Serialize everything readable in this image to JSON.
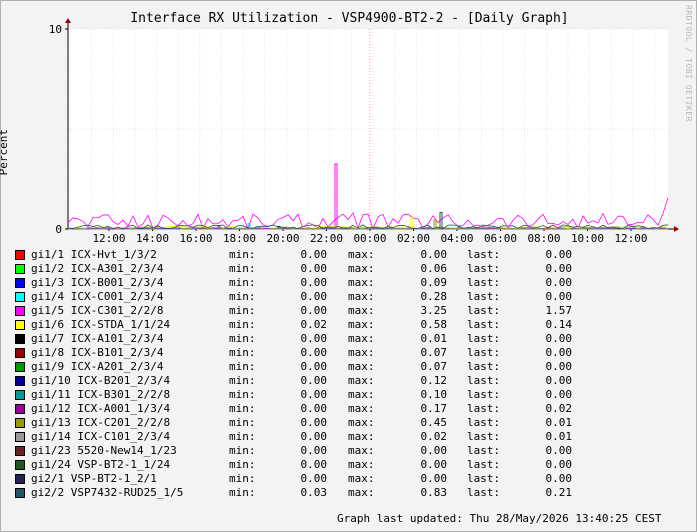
{
  "title": "Interface RX Utilization - VSP4900-BT2-2 - [Daily Graph]",
  "watermark": "RRDTOOL / TOBI OETIKER",
  "colors": {
    "background": "#f3f3f3",
    "plot_bg": "#ffffff",
    "grid": "#e8c8c8",
    "axis_arrow": "#a00000"
  },
  "chart_data": {
    "type": "line",
    "title": "Interface RX Utilization - VSP4900-BT2-2 - [Daily Graph]",
    "xlabel": "",
    "ylabel": "Percent",
    "ylim": [
      0,
      10
    ],
    "yticks": [
      "0",
      "10"
    ],
    "x_ticks": [
      "12:00",
      "14:00",
      "16:00",
      "18:00",
      "20:00",
      "22:00",
      "00:00",
      "02:00",
      "04:00",
      "06:00",
      "08:00",
      "10:00",
      "12:00"
    ],
    "x_range_hours": [
      0,
      24
    ],
    "grid": true,
    "series": [
      {
        "name": "gi1/1 ICX-Hvt_1/3/2",
        "color": "#ff0000",
        "min": "0.00",
        "max": "0.00",
        "last": "0.00"
      },
      {
        "name": "gi1/2 ICX-A301_2/3/4",
        "color": "#00ff00",
        "min": "0.00",
        "max": "0.06",
        "last": "0.00"
      },
      {
        "name": "gi1/3 ICX-B001_2/3/4",
        "color": "#0000ff",
        "min": "0.00",
        "max": "0.09",
        "last": "0.00"
      },
      {
        "name": "gi1/4 ICX-C001_2/3/4",
        "color": "#00ffff",
        "min": "0.00",
        "max": "0.28",
        "last": "0.00"
      },
      {
        "name": "gi1/5 ICX-C301_2/2/8",
        "color": "#ff00ff",
        "min": "0.00",
        "max": "3.25",
        "last": "1.57"
      },
      {
        "name": "gi1/6 ICX-STDA_1/1/24",
        "color": "#ffff00",
        "min": "0.02",
        "max": "0.58",
        "last": "0.14"
      },
      {
        "name": "gi1/7 ICX-A101_2/3/4",
        "color": "#000000",
        "min": "0.00",
        "max": "0.01",
        "last": "0.00"
      },
      {
        "name": "gi1/8 ICX-B101_2/3/4",
        "color": "#990000",
        "min": "0.00",
        "max": "0.07",
        "last": "0.00"
      },
      {
        "name": "gi1/9 ICX-A201_2/3/4",
        "color": "#009900",
        "min": "0.00",
        "max": "0.07",
        "last": "0.00"
      },
      {
        "name": "gi1/10 ICX-B201_2/3/4",
        "color": "#000099",
        "min": "0.00",
        "max": "0.12",
        "last": "0.00"
      },
      {
        "name": "gi1/11 ICX-B301_2/2/8",
        "color": "#009999",
        "min": "0.00",
        "max": "0.10",
        "last": "0.00"
      },
      {
        "name": "gi1/12 ICX-A001_1/3/4",
        "color": "#990099",
        "min": "0.00",
        "max": "0.17",
        "last": "0.02"
      },
      {
        "name": "gi1/13 ICX-C201_2/2/8",
        "color": "#999900",
        "min": "0.00",
        "max": "0.45",
        "last": "0.01"
      },
      {
        "name": "gi1/14 ICX-C101_2/3/4",
        "color": "#999999",
        "min": "0.00",
        "max": "0.02",
        "last": "0.01"
      },
      {
        "name": "gi1/23 5520-New14_1/23",
        "color": "#662222",
        "min": "0.00",
        "max": "0.00",
        "last": "0.00"
      },
      {
        "name": "gi1/24 VSP-BT2-1_1/24",
        "color": "#225522",
        "min": "0.00",
        "max": "0.00",
        "last": "0.00"
      },
      {
        "name": "gi2/1 VSP-BT2-1_2/1",
        "color": "#222255",
        "min": "0.00",
        "max": "0.00",
        "last": "0.00"
      },
      {
        "name": "gi2/2 VSP7432-RUD25_1/5",
        "color": "#225566",
        "min": "0.03",
        "max": "0.83",
        "last": "0.21"
      }
    ]
  },
  "legend_labels": {
    "min": "min:",
    "max": "max:",
    "last": "last:"
  },
  "updated": "Graph last updated: Thu 28/May/2026 13:40:25 CEST"
}
